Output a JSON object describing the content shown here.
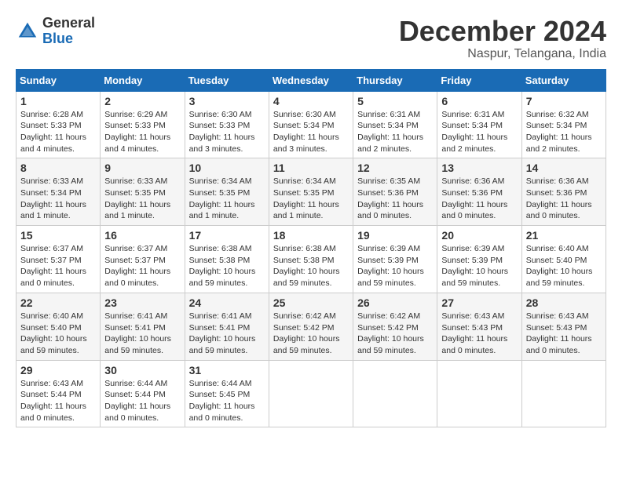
{
  "header": {
    "logo": {
      "line1": "General",
      "line2": "Blue"
    },
    "title": "December 2024",
    "location": "Naspur, Telangana, India"
  },
  "calendar": {
    "days_of_week": [
      "Sunday",
      "Monday",
      "Tuesday",
      "Wednesday",
      "Thursday",
      "Friday",
      "Saturday"
    ],
    "weeks": [
      [
        {
          "day": "1",
          "sunrise": "6:28 AM",
          "sunset": "5:33 PM",
          "daylight": "11 hours and 4 minutes."
        },
        {
          "day": "2",
          "sunrise": "6:29 AM",
          "sunset": "5:33 PM",
          "daylight": "11 hours and 4 minutes."
        },
        {
          "day": "3",
          "sunrise": "6:30 AM",
          "sunset": "5:33 PM",
          "daylight": "11 hours and 3 minutes."
        },
        {
          "day": "4",
          "sunrise": "6:30 AM",
          "sunset": "5:34 PM",
          "daylight": "11 hours and 3 minutes."
        },
        {
          "day": "5",
          "sunrise": "6:31 AM",
          "sunset": "5:34 PM",
          "daylight": "11 hours and 2 minutes."
        },
        {
          "day": "6",
          "sunrise": "6:31 AM",
          "sunset": "5:34 PM",
          "daylight": "11 hours and 2 minutes."
        },
        {
          "day": "7",
          "sunrise": "6:32 AM",
          "sunset": "5:34 PM",
          "daylight": "11 hours and 2 minutes."
        }
      ],
      [
        {
          "day": "8",
          "sunrise": "6:33 AM",
          "sunset": "5:34 PM",
          "daylight": "11 hours and 1 minute."
        },
        {
          "day": "9",
          "sunrise": "6:33 AM",
          "sunset": "5:35 PM",
          "daylight": "11 hours and 1 minute."
        },
        {
          "day": "10",
          "sunrise": "6:34 AM",
          "sunset": "5:35 PM",
          "daylight": "11 hours and 1 minute."
        },
        {
          "day": "11",
          "sunrise": "6:34 AM",
          "sunset": "5:35 PM",
          "daylight": "11 hours and 1 minute."
        },
        {
          "day": "12",
          "sunrise": "6:35 AM",
          "sunset": "5:36 PM",
          "daylight": "11 hours and 0 minutes."
        },
        {
          "day": "13",
          "sunrise": "6:36 AM",
          "sunset": "5:36 PM",
          "daylight": "11 hours and 0 minutes."
        },
        {
          "day": "14",
          "sunrise": "6:36 AM",
          "sunset": "5:36 PM",
          "daylight": "11 hours and 0 minutes."
        }
      ],
      [
        {
          "day": "15",
          "sunrise": "6:37 AM",
          "sunset": "5:37 PM",
          "daylight": "11 hours and 0 minutes."
        },
        {
          "day": "16",
          "sunrise": "6:37 AM",
          "sunset": "5:37 PM",
          "daylight": "11 hours and 0 minutes."
        },
        {
          "day": "17",
          "sunrise": "6:38 AM",
          "sunset": "5:38 PM",
          "daylight": "10 hours and 59 minutes."
        },
        {
          "day": "18",
          "sunrise": "6:38 AM",
          "sunset": "5:38 PM",
          "daylight": "10 hours and 59 minutes."
        },
        {
          "day": "19",
          "sunrise": "6:39 AM",
          "sunset": "5:39 PM",
          "daylight": "10 hours and 59 minutes."
        },
        {
          "day": "20",
          "sunrise": "6:39 AM",
          "sunset": "5:39 PM",
          "daylight": "10 hours and 59 minutes."
        },
        {
          "day": "21",
          "sunrise": "6:40 AM",
          "sunset": "5:40 PM",
          "daylight": "10 hours and 59 minutes."
        }
      ],
      [
        {
          "day": "22",
          "sunrise": "6:40 AM",
          "sunset": "5:40 PM",
          "daylight": "10 hours and 59 minutes."
        },
        {
          "day": "23",
          "sunrise": "6:41 AM",
          "sunset": "5:41 PM",
          "daylight": "10 hours and 59 minutes."
        },
        {
          "day": "24",
          "sunrise": "6:41 AM",
          "sunset": "5:41 PM",
          "daylight": "10 hours and 59 minutes."
        },
        {
          "day": "25",
          "sunrise": "6:42 AM",
          "sunset": "5:42 PM",
          "daylight": "10 hours and 59 minutes."
        },
        {
          "day": "26",
          "sunrise": "6:42 AM",
          "sunset": "5:42 PM",
          "daylight": "10 hours and 59 minutes."
        },
        {
          "day": "27",
          "sunrise": "6:43 AM",
          "sunset": "5:43 PM",
          "daylight": "11 hours and 0 minutes."
        },
        {
          "day": "28",
          "sunrise": "6:43 AM",
          "sunset": "5:43 PM",
          "daylight": "11 hours and 0 minutes."
        }
      ],
      [
        {
          "day": "29",
          "sunrise": "6:43 AM",
          "sunset": "5:44 PM",
          "daylight": "11 hours and 0 minutes."
        },
        {
          "day": "30",
          "sunrise": "6:44 AM",
          "sunset": "5:44 PM",
          "daylight": "11 hours and 0 minutes."
        },
        {
          "day": "31",
          "sunrise": "6:44 AM",
          "sunset": "5:45 PM",
          "daylight": "11 hours and 0 minutes."
        },
        null,
        null,
        null,
        null
      ]
    ]
  }
}
